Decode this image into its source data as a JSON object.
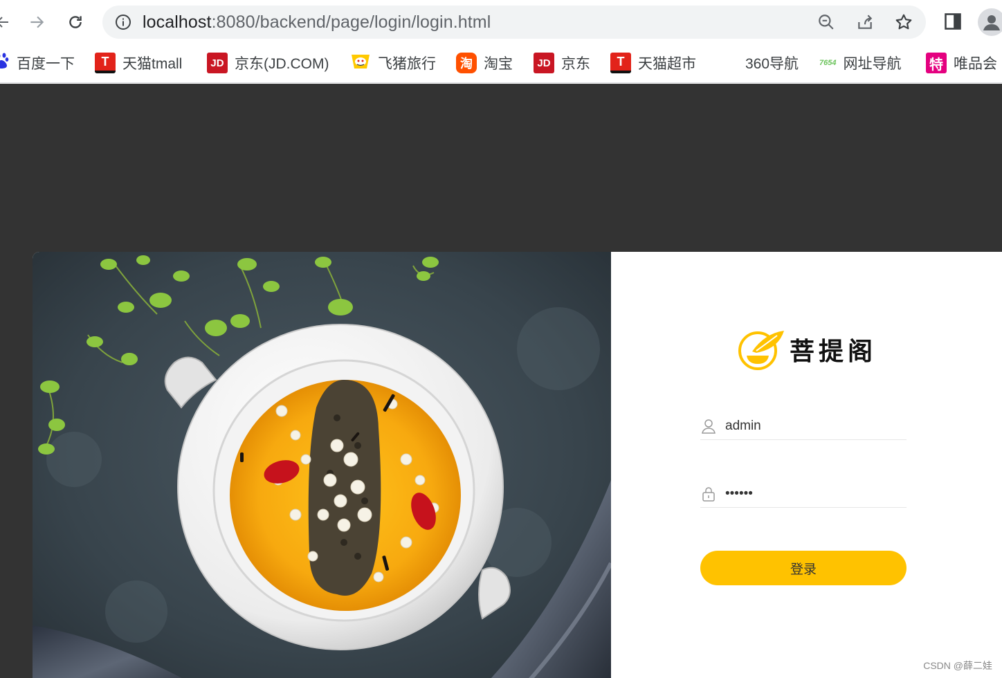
{
  "browser": {
    "url_host": "localhost",
    "url_path": ":8080/backend/page/login/login.html"
  },
  "bookmarks": [
    {
      "label": "百度一下",
      "icon": "baidu-paw-icon",
      "color": "#2932e1"
    },
    {
      "label": "天猫tmall",
      "icon": "tmall-icon",
      "color": "#e2231a"
    },
    {
      "label": "京东(JD.COM)",
      "icon": "jd-icon",
      "color": "#c91623"
    },
    {
      "label": "飞猪旅行",
      "icon": "fliggy-icon",
      "color": "#ffc900"
    },
    {
      "label": "淘宝",
      "icon": "taobao-icon",
      "color": "#ff5000"
    },
    {
      "label": "京东",
      "icon": "jd-icon",
      "color": "#c91623"
    },
    {
      "label": "天猫超市",
      "icon": "tmall-icon",
      "color": "#e2231a"
    },
    {
      "label": "360导航",
      "icon": "",
      "color": ""
    },
    {
      "label": "网址导航",
      "icon": "7654-icon",
      "color": "#6bc35b"
    },
    {
      "label": "唯品会",
      "icon": "vip-icon",
      "color": "#e4007f"
    }
  ],
  "bookmark_badges": {
    "tmall": "T",
    "jd": "JD",
    "taobao": "淘",
    "nav7654": "7654",
    "vip": "特"
  },
  "login": {
    "brand": "菩提阁",
    "username_value": "admin",
    "password_value": "123456",
    "button_label": "登录",
    "accent_color": "#ffc200"
  },
  "watermark": "CSDN @薛二娃"
}
